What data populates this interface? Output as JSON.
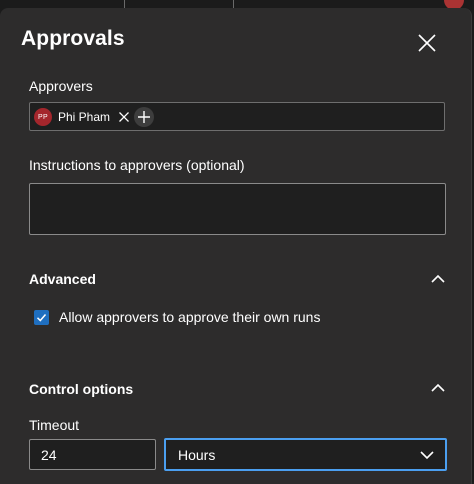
{
  "dialog": {
    "title": "Approvals"
  },
  "approvers": {
    "label": "Approvers",
    "items": [
      {
        "initials": "PP",
        "name": "Phi Pham"
      }
    ]
  },
  "instructions": {
    "label": "Instructions to approvers (optional)",
    "value": ""
  },
  "advanced": {
    "header": "Advanced",
    "allow_self_approval": {
      "label": "Allow approvers to approve their own runs",
      "checked": true
    }
  },
  "control_options": {
    "header": "Control options",
    "timeout": {
      "label": "Timeout",
      "value": "24",
      "unit": "Hours"
    }
  },
  "colors": {
    "avatar": "#a4262c",
    "checkbox": "#1f6fc0",
    "focus_border": "#4b9ff0"
  },
  "icons": {
    "close": "close-icon",
    "remove": "dismiss-icon",
    "add": "plus-icon",
    "collapse": "chevron-up-icon",
    "dropdown": "chevron-down-icon",
    "check": "checkmark-icon"
  }
}
